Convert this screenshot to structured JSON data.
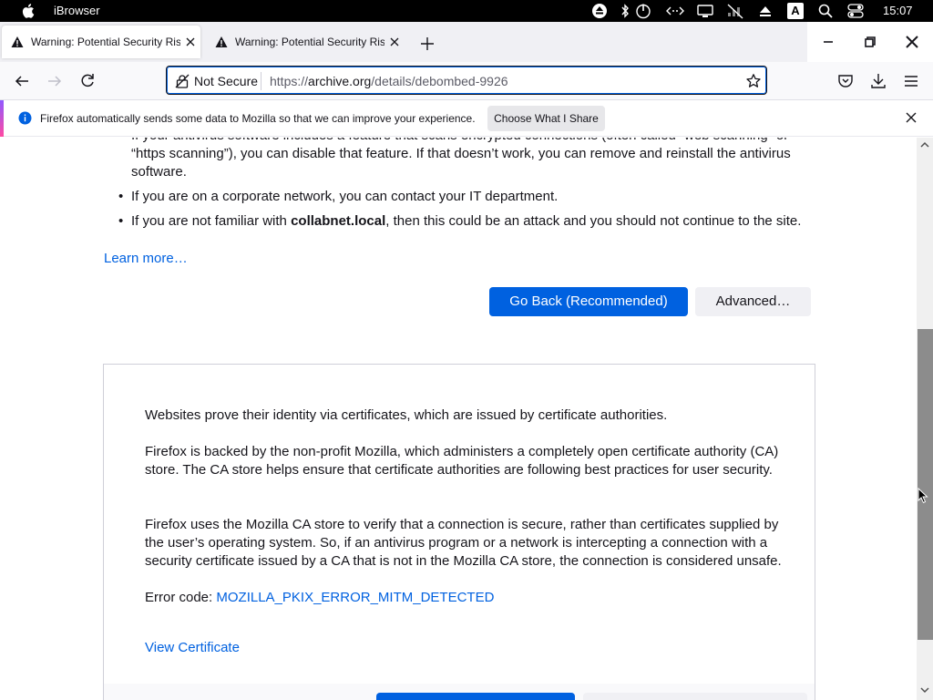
{
  "os": {
    "app_name": "iBrowser",
    "clock": "15:07",
    "tray_icons": [
      "eject-icon",
      "bluetooth-icon",
      "power-icon",
      "remote-desktop-icon",
      "display-icon",
      "muted-icon",
      "upload-icon",
      "keyboard-input-icon",
      "search-icon",
      "control-center-icon"
    ],
    "keyboard_letter": "A"
  },
  "tabs": [
    {
      "title": "Warning: Potential Security Risk Ahead",
      "active": true
    },
    {
      "title": "Warning: Potential Security Risk Ahead",
      "active": false
    }
  ],
  "navbar": {
    "not_secure_label": "Not Secure",
    "url_prefix": "https://",
    "url_domain": "archive.org",
    "url_path": "/details/debombed-9926"
  },
  "notification": {
    "message": "Firefox automatically sends some data to Mozilla so that we can improve your experience.",
    "button_label": "Choose What I Share"
  },
  "content": {
    "bullets": [
      {
        "text": "If your antivirus software includes a feature that scans encrypted connections (often called “web scanning” or “https scanning”), you can disable that feature. If that doesn’t work, you can remove and reinstall the antivirus software."
      },
      {
        "text": "If you are on a corporate network, you can contact your IT department."
      },
      {
        "pre": "If you are not familiar with ",
        "bold": "collabnet.local",
        "post": ", then this could be an attack and you should not continue to the site."
      }
    ],
    "learn_more": "Learn more…",
    "go_back_label": "Go Back (Recommended)",
    "advanced_label": "Advanced…"
  },
  "advanced_panel": {
    "para1": "Websites prove their identity via certificates, which are issued by certificate authorities.",
    "para2": "Firefox is backed by the non-profit Mozilla, which administers a completely open certificate authority (CA) store. The CA store helps ensure that certificate authorities are following best practices for user security.",
    "para3": "Firefox uses the Mozilla CA store to verify that a connection is secure, rather than certificates supplied by the user’s operating system. So, if an antivirus program or a network is intercepting a connection with a security certificate issued by a CA that is not in the Mozilla CA store, the connection is considered unsafe.",
    "error_code_label": "Error code: ",
    "error_code": "MOZILLA_PKIX_ERROR_MITM_DETECTED",
    "view_certificate": "View Certificate"
  },
  "colors": {
    "accent": "#0061e0",
    "os_bar": "#000000",
    "tab_strip": "#f0f0f4"
  }
}
